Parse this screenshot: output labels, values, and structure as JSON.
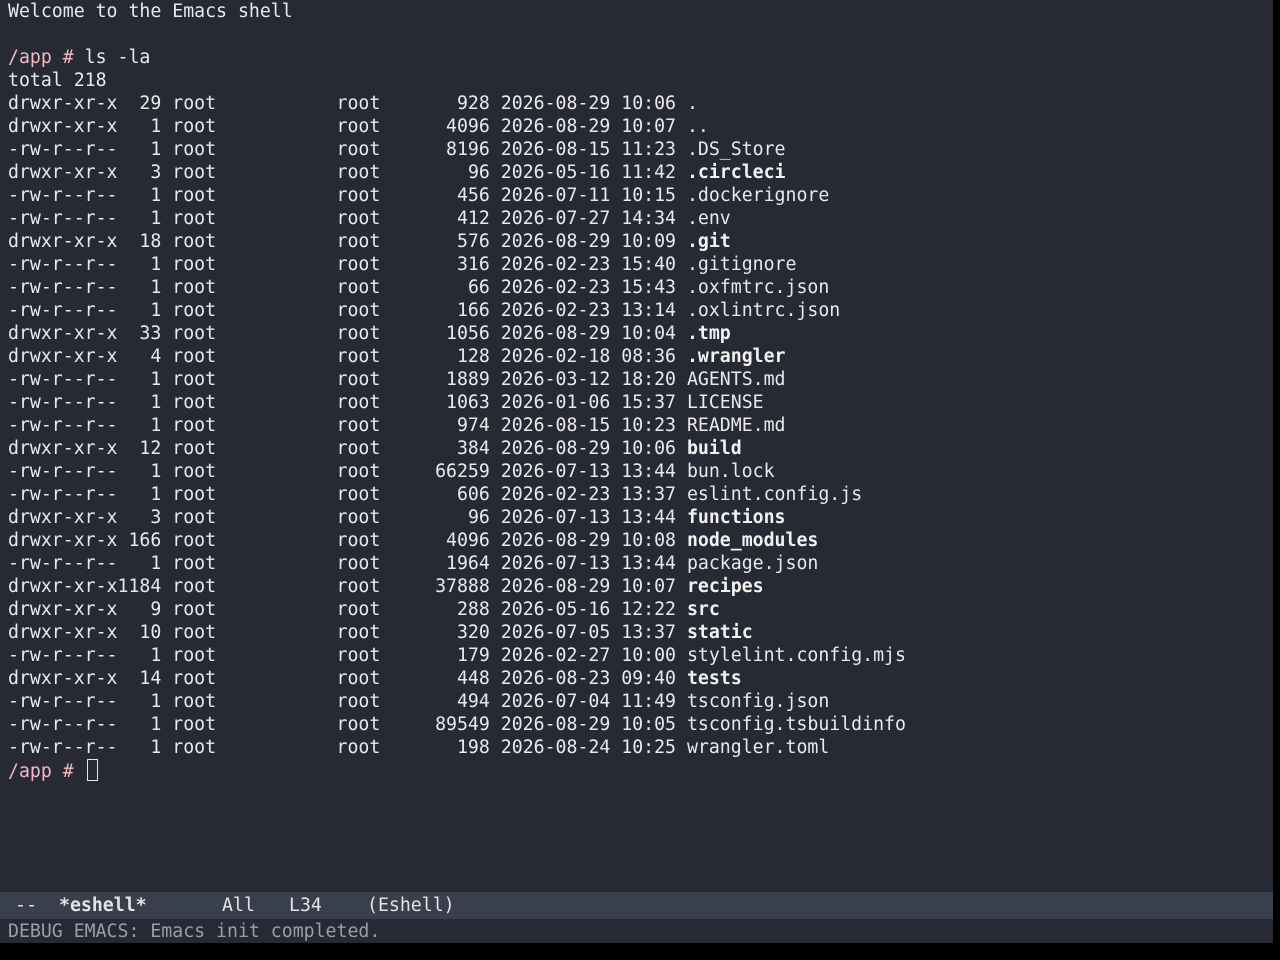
{
  "buffer": {
    "welcome": "Welcome to the Emacs shell",
    "prompt": "/app #",
    "command": " ls -la",
    "total": "total 218",
    "listing": [
      {
        "mode": "drwxr-xr-x  29",
        "owner": " root",
        "group": "root",
        "size": "928",
        "date": "2026-08-29 10:06",
        "name": ".",
        "dir": false
      },
      {
        "mode": "drwxr-xr-x   1",
        "owner": " root",
        "group": "root",
        "size": "4096",
        "date": "2026-08-29 10:07",
        "name": "..",
        "dir": false
      },
      {
        "mode": "-rw-r--r--   1",
        "owner": " root",
        "group": "root",
        "size": "8196",
        "date": "2026-08-15 11:23",
        "name": ".DS_Store",
        "dir": false
      },
      {
        "mode": "drwxr-xr-x   3",
        "owner": " root",
        "group": "root",
        "size": "96",
        "date": "2026-05-16 11:42",
        "name": ".circleci",
        "dir": true
      },
      {
        "mode": "-rw-r--r--   1",
        "owner": " root",
        "group": "root",
        "size": "456",
        "date": "2026-07-11 10:15",
        "name": ".dockerignore",
        "dir": false
      },
      {
        "mode": "-rw-r--r--   1",
        "owner": " root",
        "group": "root",
        "size": "412",
        "date": "2026-07-27 14:34",
        "name": ".env",
        "dir": false
      },
      {
        "mode": "drwxr-xr-x  18",
        "owner": " root",
        "group": "root",
        "size": "576",
        "date": "2026-08-29 10:09",
        "name": ".git",
        "dir": true
      },
      {
        "mode": "-rw-r--r--   1",
        "owner": " root",
        "group": "root",
        "size": "316",
        "date": "2026-02-23 15:40",
        "name": ".gitignore",
        "dir": false
      },
      {
        "mode": "-rw-r--r--   1",
        "owner": " root",
        "group": "root",
        "size": "66",
        "date": "2026-02-23 15:43",
        "name": ".oxfmtrc.json",
        "dir": false
      },
      {
        "mode": "-rw-r--r--   1",
        "owner": " root",
        "group": "root",
        "size": "166",
        "date": "2026-02-23 13:14",
        "name": ".oxlintrc.json",
        "dir": false
      },
      {
        "mode": "drwxr-xr-x  33",
        "owner": " root",
        "group": "root",
        "size": "1056",
        "date": "2026-08-29 10:04",
        "name": ".tmp",
        "dir": true
      },
      {
        "mode": "drwxr-xr-x   4",
        "owner": " root",
        "group": "root",
        "size": "128",
        "date": "2026-02-18 08:36",
        "name": ".wrangler",
        "dir": true
      },
      {
        "mode": "-rw-r--r--   1",
        "owner": " root",
        "group": "root",
        "size": "1889",
        "date": "2026-03-12 18:20",
        "name": "AGENTS.md",
        "dir": false
      },
      {
        "mode": "-rw-r--r--   1",
        "owner": " root",
        "group": "root",
        "size": "1063",
        "date": "2026-01-06 15:37",
        "name": "LICENSE",
        "dir": false
      },
      {
        "mode": "-rw-r--r--   1",
        "owner": " root",
        "group": "root",
        "size": "974",
        "date": "2026-08-15 10:23",
        "name": "README.md",
        "dir": false
      },
      {
        "mode": "drwxr-xr-x  12",
        "owner": " root",
        "group": "root",
        "size": "384",
        "date": "2026-08-29 10:06",
        "name": "build",
        "dir": true
      },
      {
        "mode": "-rw-r--r--   1",
        "owner": " root",
        "group": "root",
        "size": "66259",
        "date": "2026-07-13 13:44",
        "name": "bun.lock",
        "dir": false
      },
      {
        "mode": "-rw-r--r--   1",
        "owner": " root",
        "group": "root",
        "size": "606",
        "date": "2026-02-23 13:37",
        "name": "eslint.config.js",
        "dir": false
      },
      {
        "mode": "drwxr-xr-x   3",
        "owner": " root",
        "group": "root",
        "size": "96",
        "date": "2026-07-13 13:44",
        "name": "functions",
        "dir": true
      },
      {
        "mode": "drwxr-xr-x 166",
        "owner": " root",
        "group": "root",
        "size": "4096",
        "date": "2026-08-29 10:08",
        "name": "node_modules",
        "dir": true
      },
      {
        "mode": "-rw-r--r--   1",
        "owner": " root",
        "group": "root",
        "size": "1964",
        "date": "2026-07-13 13:44",
        "name": "package.json",
        "dir": false
      },
      {
        "mode": "drwxr-xr-x1184",
        "owner": " root",
        "group": "root",
        "size": "37888",
        "date": "2026-08-29 10:07",
        "name": "recipes",
        "dir": true
      },
      {
        "mode": "drwxr-xr-x   9",
        "owner": " root",
        "group": "root",
        "size": "288",
        "date": "2026-05-16 12:22",
        "name": "src",
        "dir": true
      },
      {
        "mode": "drwxr-xr-x  10",
        "owner": " root",
        "group": "root",
        "size": "320",
        "date": "2026-07-05 13:37",
        "name": "static",
        "dir": true
      },
      {
        "mode": "-rw-r--r--   1",
        "owner": " root",
        "group": "root",
        "size": "179",
        "date": "2026-02-27 10:00",
        "name": "stylelint.config.mjs",
        "dir": false
      },
      {
        "mode": "drwxr-xr-x  14",
        "owner": " root",
        "group": "root",
        "size": "448",
        "date": "2026-08-23 09:40",
        "name": "tests",
        "dir": true
      },
      {
        "mode": "-rw-r--r--   1",
        "owner": " root",
        "group": "root",
        "size": "494",
        "date": "2026-07-04 11:49",
        "name": "tsconfig.json",
        "dir": false
      },
      {
        "mode": "-rw-r--r--   1",
        "owner": " root",
        "group": "root",
        "size": "89549",
        "date": "2026-08-29 10:05",
        "name": "tsconfig.tsbuildinfo",
        "dir": false
      },
      {
        "mode": "-rw-r--r--   1",
        "owner": " root",
        "group": "root",
        "size": "198",
        "date": "2026-08-24 10:25",
        "name": "wrangler.toml",
        "dir": false
      }
    ]
  },
  "modeline": {
    "status": "--",
    "buffer_name": "*eshell*",
    "position": "All",
    "line": "L34",
    "mode": "(Eshell)"
  },
  "minibuffer": {
    "message": "DEBUG EMACS: Emacs init completed."
  },
  "colors": {
    "background": "#272a35",
    "prompt": "#f4b8c0",
    "modeline_bg": "#3a3f4e"
  }
}
